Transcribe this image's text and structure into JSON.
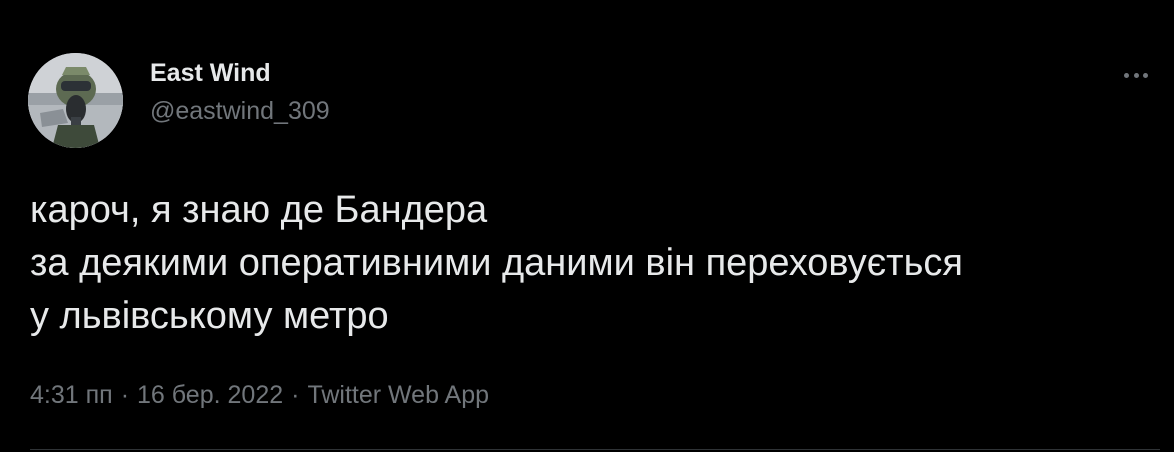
{
  "author": {
    "display_name": "East Wind",
    "handle": "@eastwind_309"
  },
  "icons": {
    "more": "more-horizontal-icon",
    "avatar": "avatar-image"
  },
  "tweet": {
    "lines": [
      "кароч, я знаю де Бандера",
      "за деякими оперативними даними він переховується",
      "у львівському метро"
    ]
  },
  "meta": {
    "time": "4:31 пп",
    "separator": "·",
    "date": "16 бер. 2022",
    "source": "Twitter Web App"
  },
  "colors": {
    "background": "#000000",
    "primary_text": "#e7e9ea",
    "secondary_text": "#71767b",
    "divider": "#2f3336"
  }
}
